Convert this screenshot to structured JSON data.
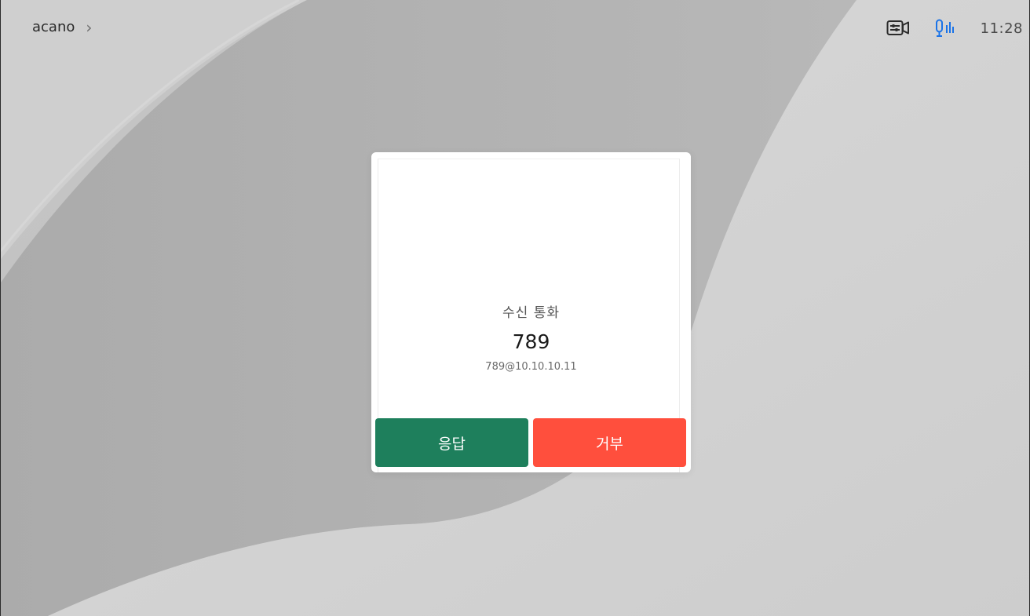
{
  "topbar": {
    "device_name": "acano",
    "chevron": "›",
    "icons": {
      "camera_control": "camera-settings-icon",
      "mic_status": "microphone-levels-icon"
    },
    "clock": "11:28"
  },
  "incoming_call": {
    "label": "수신 통화",
    "caller_name": "789",
    "caller_uri": "789@10.10.10.11",
    "answer_label": "응답",
    "decline_label": "거부"
  },
  "colors": {
    "answer": "#1e7f5c",
    "decline": "#ff4f3d",
    "mic_icon": "#1a73e8"
  }
}
